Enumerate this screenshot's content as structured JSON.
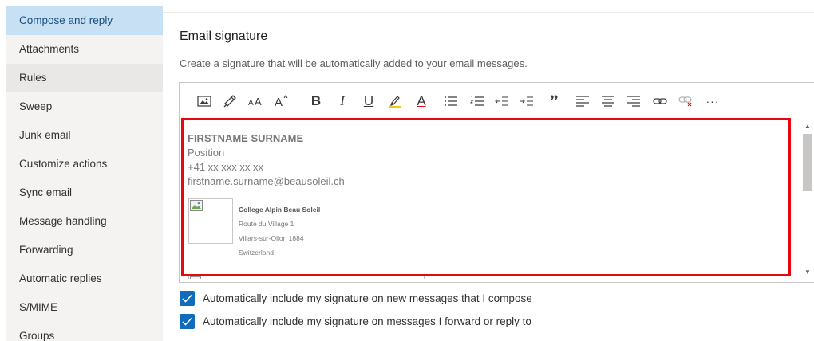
{
  "sidebar": {
    "items": [
      {
        "label": "Compose and reply"
      },
      {
        "label": "Attachments"
      },
      {
        "label": "Rules"
      },
      {
        "label": "Sweep"
      },
      {
        "label": "Junk email"
      },
      {
        "label": "Customize actions"
      },
      {
        "label": "Sync email"
      },
      {
        "label": "Message handling"
      },
      {
        "label": "Forwarding"
      },
      {
        "label": "Automatic replies"
      },
      {
        "label": "S/MIME"
      },
      {
        "label": "Groups"
      }
    ],
    "selected": "Compose and reply"
  },
  "main": {
    "title": "Email signature",
    "description": "Create a signature that will be automatically added to your email messages."
  },
  "toolbar": {
    "icons": [
      "insert-image-icon",
      "format-painter-icon",
      "font-size-icon",
      "grow-font-icon",
      "bold-icon",
      "italic-icon",
      "underline-icon",
      "highlight-icon",
      "font-color-icon",
      "bullets-icon",
      "numbering-icon",
      "decrease-indent-icon",
      "increase-indent-icon",
      "quote-icon",
      "align-left-icon",
      "align-center-icon",
      "align-right-icon",
      "link-icon",
      "remove-link-icon",
      "more-icon"
    ],
    "bold_glyph": "B",
    "italic_glyph": "I",
    "underline_glyph": "U",
    "font_color_glyph": "A",
    "quote_glyph": "”",
    "more_glyph": "···"
  },
  "signature": {
    "name": "FIRSTNAME SURNAME",
    "position": "Position",
    "phone": "+41 xx xxx xx xx",
    "email": "firstname.surname@beausoleil.ch",
    "school": "College Alpin Beau Soleil",
    "address1": "Route du Village 1",
    "address2": "Villars-sur-Ollon 1884",
    "country": "Switzerland"
  },
  "checkboxes": [
    {
      "label": "Automatically include my signature on new messages that I compose",
      "checked": true
    },
    {
      "label": "Automatically include my signature on messages I forward or reply to",
      "checked": true
    }
  ],
  "colors": {
    "accent": "#0f6cbd",
    "selected_bg": "#c7e0f4",
    "highlight": "#e8070c"
  }
}
